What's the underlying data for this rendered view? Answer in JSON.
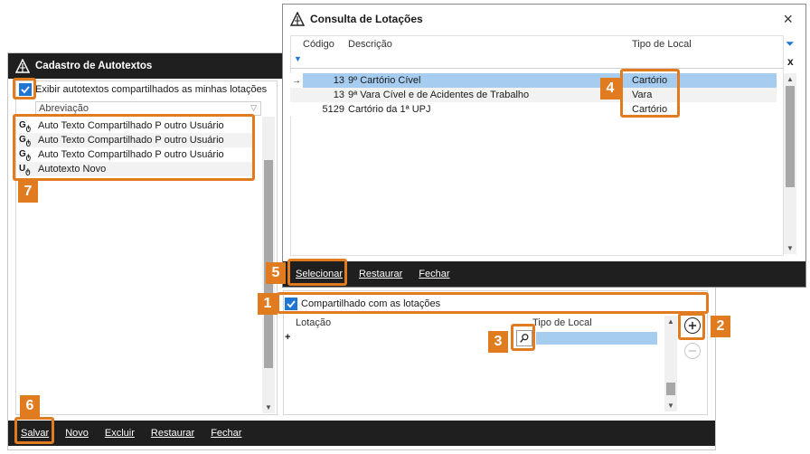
{
  "autotextos_window": {
    "title": "Cadastro de Autotextos",
    "checkbox_label": "Exibir autotextos compartilhados as minhas lotações",
    "column_header": "Abreviação",
    "items": [
      {
        "icon": "shared-group-icon",
        "label": "Auto Texto Compartilhado P outro Usuário"
      },
      {
        "icon": "shared-group-icon",
        "label": "Auto Texto Compartilhado P outro Usuário"
      },
      {
        "icon": "shared-group-icon",
        "label": "Auto Texto Compartilhado P outro Usuário"
      },
      {
        "icon": "shared-user-icon",
        "label": "Autotexto Novo"
      }
    ],
    "shared_checkbox_label": "Compartilhado com as lotações",
    "lotacao_header": "Lotação",
    "tipo_local_header": "Tipo de Local",
    "new_row_marker": "+",
    "footer": [
      "Salvar",
      "Novo",
      "Excluir",
      "Restaurar",
      "Fechar"
    ]
  },
  "lotacoes_window": {
    "title": "Consulta de Lotações",
    "headers": {
      "codigo": "Código",
      "descricao": "Descrição",
      "tipo": "Tipo de Local"
    },
    "rows": [
      {
        "marker": "→",
        "codigo": "13",
        "descricao": "9º Cartório Cível",
        "tipo": "Cartório",
        "selected": true
      },
      {
        "marker": "",
        "codigo": "13",
        "descricao": "9ª Vara Cível e de Acidentes de Trabalho",
        "tipo": "Vara",
        "selected": false
      },
      {
        "marker": "",
        "codigo": "5129",
        "descricao": "Cartório da 1ª UPJ",
        "tipo": "Cartório",
        "selected": false
      }
    ],
    "close_label": "×",
    "clear_filter_label": "x",
    "footer": [
      "Selecionar",
      "Restaurar",
      "Fechar"
    ]
  },
  "badges": [
    "1",
    "2",
    "3",
    "4",
    "5",
    "6",
    "7"
  ],
  "colors": {
    "highlight": "#e07b1f",
    "selection": "#a6cdf0",
    "titlebar": "#1f1f1f",
    "check": "#1e76d2"
  }
}
